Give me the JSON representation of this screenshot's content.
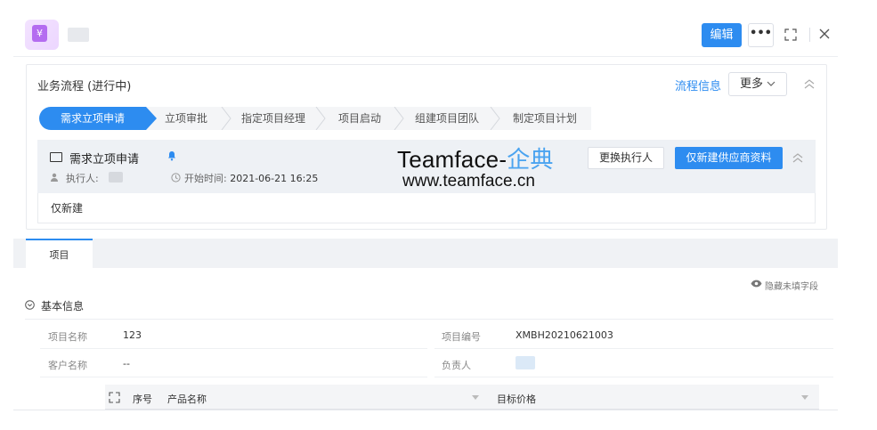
{
  "header": {
    "app_icon_glyph": "¥",
    "edit_label": "编辑",
    "more_label": "•••",
    "accent": "#2d8cf0"
  },
  "workflow": {
    "title": "业务流程 (进行中)",
    "info_link": "流程信息",
    "more_label": "更多",
    "steps": [
      {
        "label": "需求立项申请",
        "active": true
      },
      {
        "label": "立项审批"
      },
      {
        "label": "指定项目经理"
      },
      {
        "label": "项目启动"
      },
      {
        "label": "组建项目团队"
      },
      {
        "label": "制定项目计划"
      }
    ],
    "node": {
      "name": "需求立项申请",
      "executor_label": "执行人:",
      "start_label": "开始时间:",
      "start_time": "2021-06-21 16:25",
      "change_executor_label": "更换执行人",
      "new_supplier_label": "仅新建供应商资料",
      "result_text": "仅新建"
    },
    "watermark": {
      "brand_prefix": "Teamface-",
      "brand_suffix": "企典",
      "url": "www.teamface.cn"
    }
  },
  "tabs": [
    {
      "label": "项目",
      "active": true
    }
  ],
  "hide_empty_label": "隐藏未填字段",
  "basic_info": {
    "section_title": "基本信息",
    "fields": {
      "project_name_label": "项目名称",
      "project_name_value": "123",
      "project_no_label": "项目编号",
      "project_no_value": "XMBH20210621003",
      "customer_label": "客户名称",
      "customer_value": "--",
      "owner_label": "负责人"
    }
  },
  "product_table": {
    "columns": [
      "序号",
      "产品名称",
      "目标价格"
    ]
  }
}
